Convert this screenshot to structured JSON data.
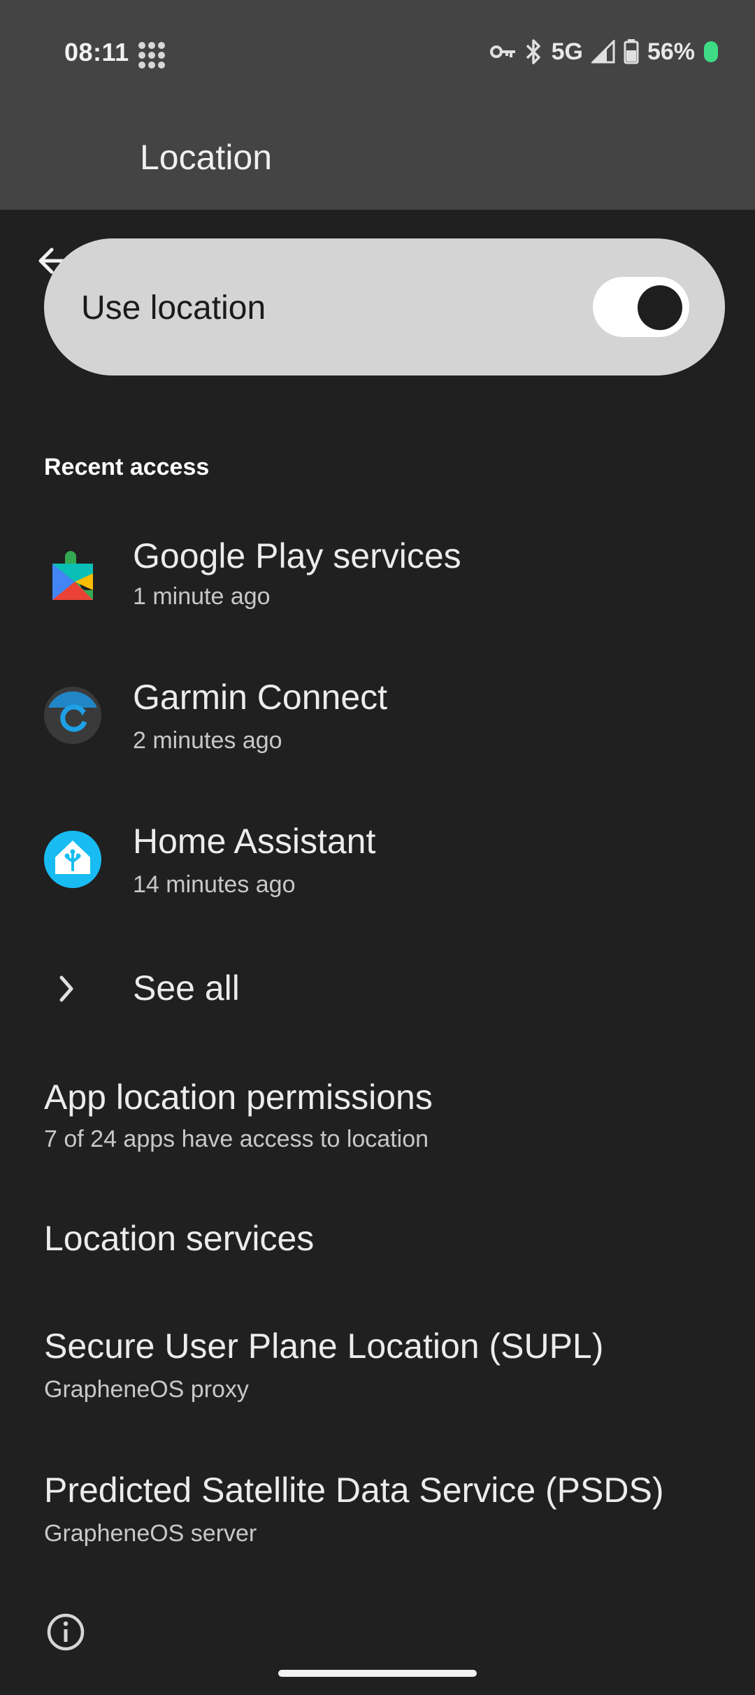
{
  "status_bar": {
    "time": "08:11",
    "network": "5G",
    "battery": "56%",
    "icons": [
      "dots-grid-icon",
      "vpn-key-icon",
      "bluetooth-icon",
      "signal-icon",
      "battery-icon",
      "charging-dot-icon"
    ]
  },
  "app_bar": {
    "title": "Location",
    "back_icon": "arrow-back-icon"
  },
  "main_toggle": {
    "label": "Use location",
    "checked": true
  },
  "recent_access": {
    "header": "Recent access",
    "items": [
      {
        "name": "Google Play services",
        "time": "1 minute ago",
        "icon": "google-play-services-icon"
      },
      {
        "name": "Garmin Connect",
        "time": "2 minutes ago",
        "icon": "garmin-connect-icon"
      },
      {
        "name": "Home Assistant",
        "time": "14 minutes ago",
        "icon": "home-assistant-icon"
      }
    ],
    "see_all": "See all"
  },
  "settings": [
    {
      "title": "App location permissions",
      "summary": "7 of 24 apps have access to location"
    },
    {
      "title": "Location services",
      "summary": ""
    },
    {
      "title": "Secure User Plane Location (SUPL)",
      "summary": "GrapheneOS proxy"
    },
    {
      "title": "Predicted Satellite Data Service (PSDS)",
      "summary": "GrapheneOS server"
    }
  ],
  "footer": {
    "info_icon": "info-icon"
  },
  "colors": {
    "background": "#202020",
    "app_bar": "#444444",
    "toggle_card": "#d4d4d4",
    "battery_green": "#3ddc84",
    "home_assistant_blue": "#18bcf2"
  }
}
